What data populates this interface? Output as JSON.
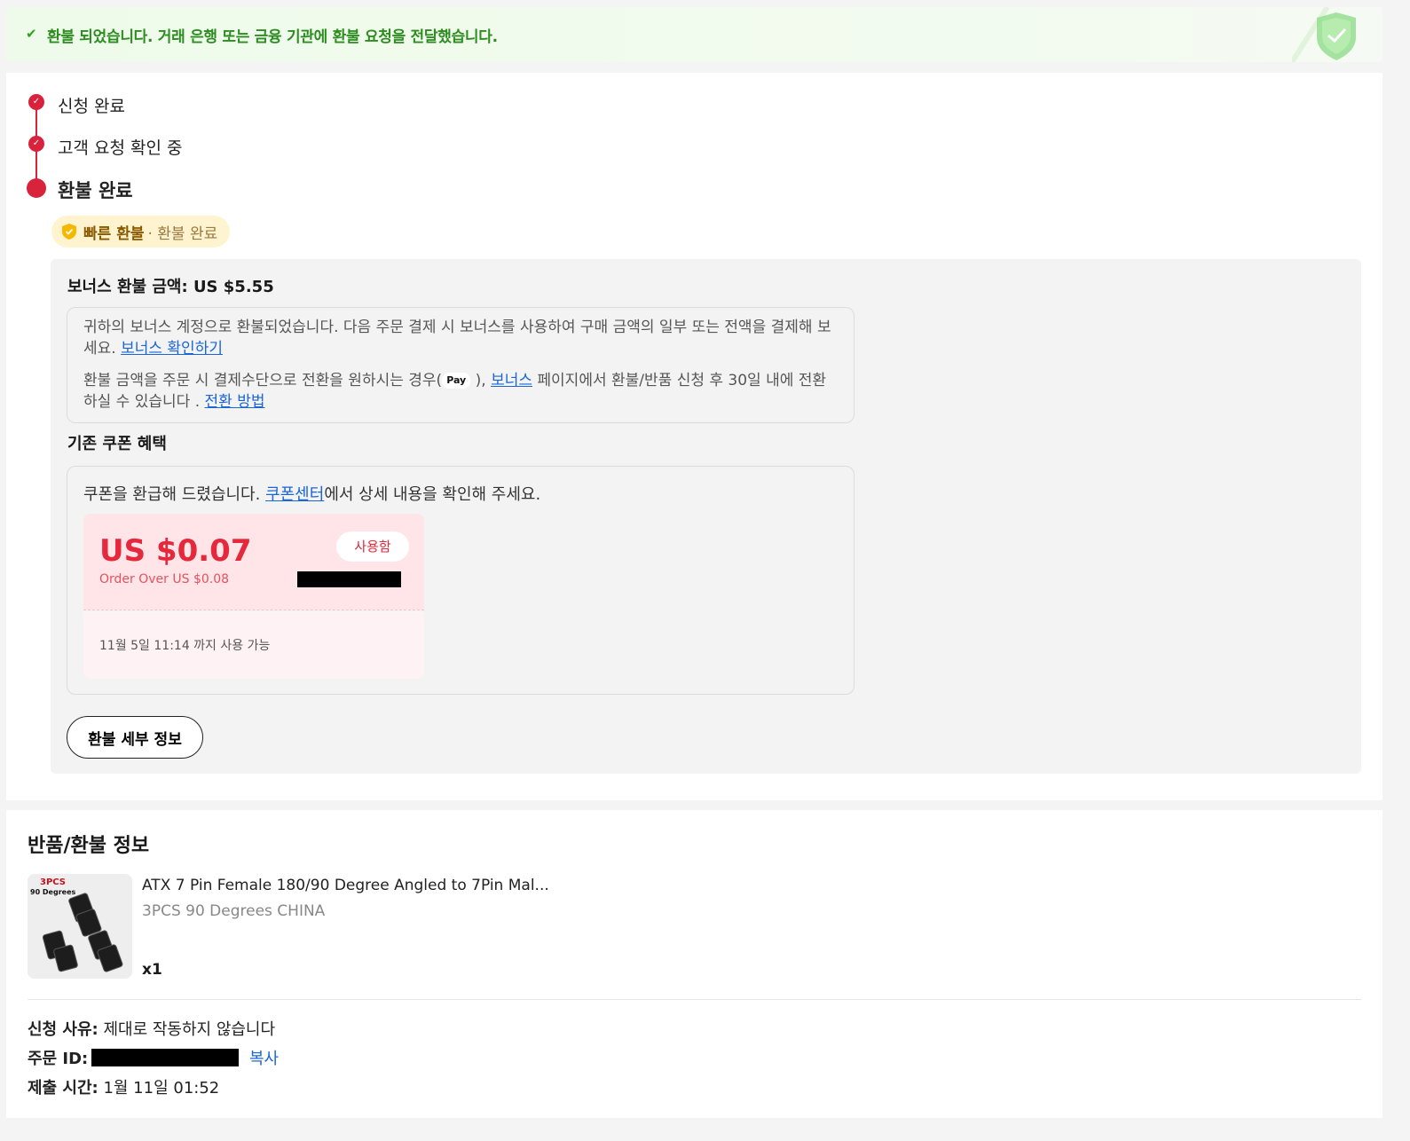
{
  "banner": {
    "message": "환불 되었습니다. 거래 은행 또는 금융 기관에 환불 요청을 전달했습니다."
  },
  "steps": [
    {
      "label": "신청 완료"
    },
    {
      "label": "고객 요청 확인 중"
    },
    {
      "label": "환불 완료"
    }
  ],
  "fast_refund": {
    "title": "빠른 환불",
    "status": "· 환불 완료"
  },
  "bonus": {
    "title": "보너스 환불 금액:",
    "amount": "US $5.55",
    "line1": "귀하의 보너스 계정으로 환불되었습니다. 다음 주문 결제 시 보너스를 사용하여 구매 금액의 일부 또는 전액을 결제해 보세요.",
    "link1": "보너스 확인하기",
    "line2_pre": "환불 금액을 주문 시 결제수단으로 전환을 원하시는 경우(",
    "apple_pay": " Pay",
    "line2_mid": "),",
    "link2": "보너스",
    "line2_post": "페이지에서 환불/반품 신청 후 30일 내에 전환하실 수 있습니다 .",
    "link3": "전환 방법"
  },
  "coupon_section": {
    "title": "기존 쿠폰 혜택",
    "intro_pre": "쿠폰을 환급해 드렸습니다.",
    "link": "쿠폰센터",
    "intro_post": "에서 상세 내용을 확인해 주세요.",
    "coupon": {
      "amount": "US $0.07",
      "condition": "Order Over US $0.08",
      "status": "사용함",
      "valid_until": "11월 5일 11:14 까지 사용 가능"
    }
  },
  "detail_button": "환불 세부 정보",
  "return_info": {
    "title": "반품/환불 정보",
    "product": {
      "name": "ATX 7 Pin Female 180/90 Degree Angled to 7Pin Mal...",
      "variant": "3PCS 90 Degrees CHINA",
      "qty": "x1",
      "thumb_text1": "3PCS",
      "thumb_text2": "90 Degrees"
    },
    "reason_label": "신청 사유:",
    "reason_value": "제대로 작동하지 않습니다",
    "order_label": "주문 ID:",
    "copy": "복사",
    "time_label": "제출 시간:",
    "time_value": "1월 11일 01:52"
  },
  "colors": {
    "accent": "#d9233c",
    "success": "#2e8d21",
    "link": "#1b66d6"
  }
}
